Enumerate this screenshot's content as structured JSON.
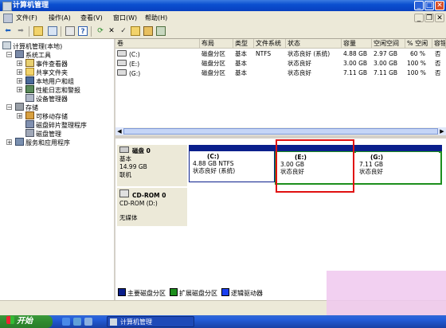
{
  "window": {
    "title": "计算机管理"
  },
  "menu": [
    "文件(F)",
    "操作(A)",
    "查看(V)",
    "窗口(W)",
    "帮助(H)"
  ],
  "toolbar": {
    "icons": [
      "back-icon",
      "forward-icon",
      "up-icon",
      "show-tree-icon",
      "properties-icon",
      "help-icon",
      "refresh-icon",
      "delete-icon",
      "checkmark-icon",
      "open-icon",
      "search-icon",
      "export-icon"
    ]
  },
  "tree": {
    "root": "计算机管理(本地)",
    "system_tools": "系统工具",
    "event_viewer": "事件查看器",
    "shared_folders": "共享文件夹",
    "local_users": "本地用户和组",
    "perf_logs": "性能日志和警报",
    "device_manager": "设备管理器",
    "storage": "存储",
    "removable": "可移动存储",
    "defrag": "磁盘碎片整理程序",
    "disk_mgmt": "磁盘管理",
    "services": "服务和应用程序"
  },
  "volume_list": {
    "headers": [
      "卷",
      "布局",
      "类型",
      "文件系统",
      "状态",
      "容量",
      "空闲空间",
      "% 空闲",
      "容错"
    ],
    "rows": [
      {
        "vol": "(C:)",
        "layout": "磁盘分区",
        "type": "基本",
        "fs": "NTFS",
        "status": "状态良好 (系统)",
        "cap": "4.88 GB",
        "free": "2.97 GB",
        "pct": "60 %",
        "ft": "否"
      },
      {
        "vol": "(E:)",
        "layout": "磁盘分区",
        "type": "基本",
        "fs": "",
        "status": "状态良好",
        "cap": "3.00 GB",
        "free": "3.00 GB",
        "pct": "100 %",
        "ft": "否"
      },
      {
        "vol": "(G:)",
        "layout": "磁盘分区",
        "type": "基本",
        "fs": "",
        "status": "状态良好",
        "cap": "7.11 GB",
        "free": "7.11 GB",
        "pct": "100 %",
        "ft": "否"
      }
    ]
  },
  "disk0": {
    "name": "磁盘 0",
    "type": "基本",
    "size": "14.99 GB",
    "state": "联机"
  },
  "partitions": [
    {
      "label": "(C:)",
      "line2": "4.88 GB NTFS",
      "line3": "状态良好 (系统)"
    },
    {
      "label": "(E:)",
      "line2": "3.00 GB",
      "line3": "状态良好"
    },
    {
      "label": "(G:)",
      "line2": "7.11 GB",
      "line3": "状态良好"
    }
  ],
  "cdrom0": {
    "name": "CD-ROM 0",
    "drive": "CD-ROM (D:)",
    "state": "无媒体"
  },
  "legend": {
    "primary": "主要磁盘分区",
    "extended": "扩展磁盘分区",
    "logical": "逻辑驱动器"
  },
  "colors": {
    "primary": "#0a1f8c",
    "extended": "#1d8f1d",
    "logical": "#1a3ff0",
    "highlight": "#e01010"
  },
  "taskbar": {
    "start": "开始",
    "task": "计算机管理"
  }
}
